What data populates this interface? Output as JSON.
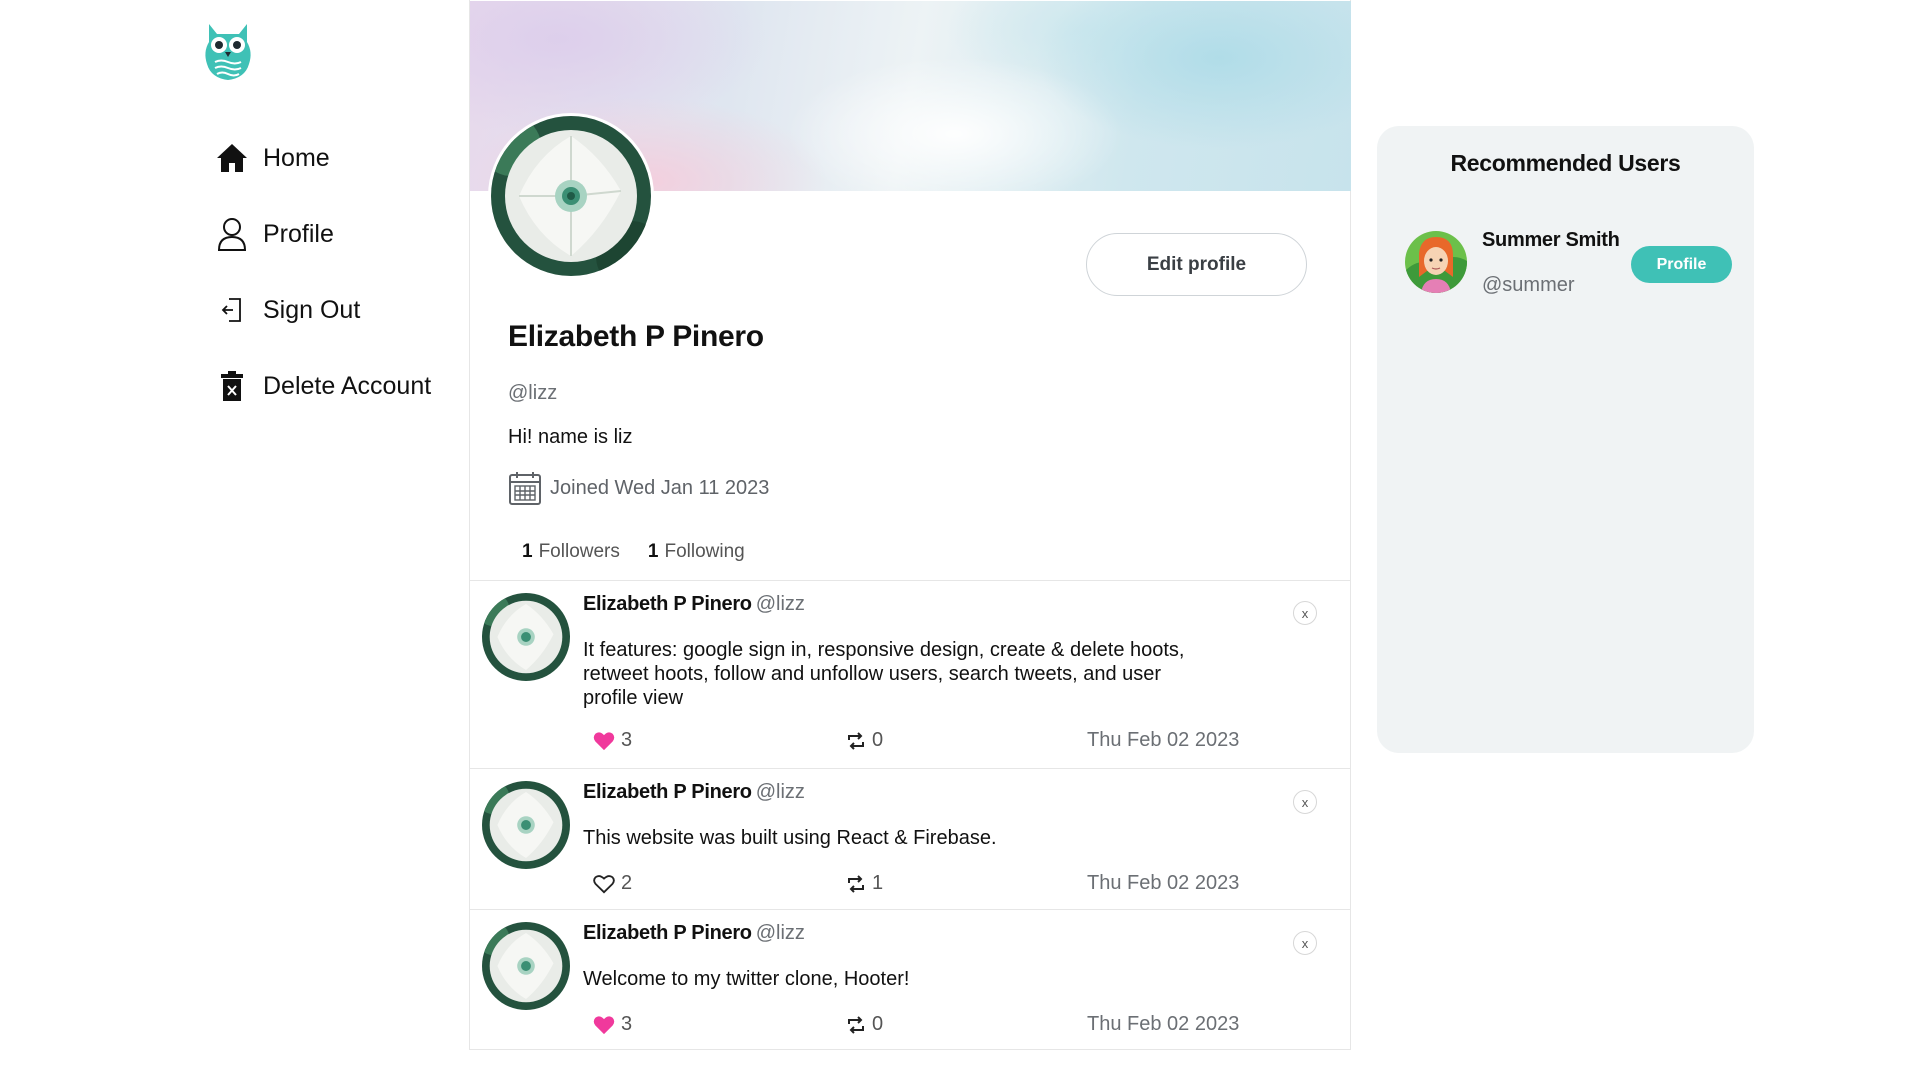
{
  "brand": {
    "logo_icon": "owl-logo-icon",
    "accent": "#3fc1b6"
  },
  "nav": {
    "items": [
      {
        "label": "Home",
        "icon": "home-icon"
      },
      {
        "label": "Profile",
        "icon": "user-icon"
      },
      {
        "label": "Sign Out",
        "icon": "sign-out-icon"
      },
      {
        "label": "Delete Account",
        "icon": "trash-icon"
      }
    ]
  },
  "profile": {
    "name": "Elizabeth P Pinero",
    "handle": "@lizz",
    "bio": "Hi! name is liz",
    "joined": "Joined Wed Jan 11 2023",
    "edit_label": "Edit profile",
    "followers_count": "1",
    "followers_label": "Followers",
    "following_count": "1",
    "following_label": "Following"
  },
  "hoots": [
    {
      "name": "Elizabeth P Pinero",
      "handle": "@lizz",
      "text": "It features: google sign in, responsive design, create & delete hoots, retweet hoots, follow and unfollow users, search tweets, and user profile view",
      "likes": "3",
      "liked": true,
      "retweets": "0",
      "date": "Thu Feb 02 2023",
      "close_label": "x"
    },
    {
      "name": "Elizabeth P Pinero",
      "handle": "@lizz",
      "text": "This website was built using React & Firebase.",
      "likes": "2",
      "liked": false,
      "retweets": "1",
      "date": "Thu Feb 02 2023",
      "close_label": "x"
    },
    {
      "name": "Elizabeth P Pinero",
      "handle": "@lizz",
      "text": "Welcome to my twitter clone, Hooter!",
      "likes": "3",
      "liked": true,
      "retweets": "0",
      "date": "Thu Feb 02 2023",
      "close_label": "x"
    }
  ],
  "recommended": {
    "title": "Recommended Users",
    "users": [
      {
        "name": "Summer Smith",
        "handle": "@summer",
        "button": "Profile"
      }
    ]
  },
  "colors": {
    "like_active": "#f0399c",
    "muted_text": "#6b6f74",
    "panel_bg": "#f0f3f4"
  }
}
